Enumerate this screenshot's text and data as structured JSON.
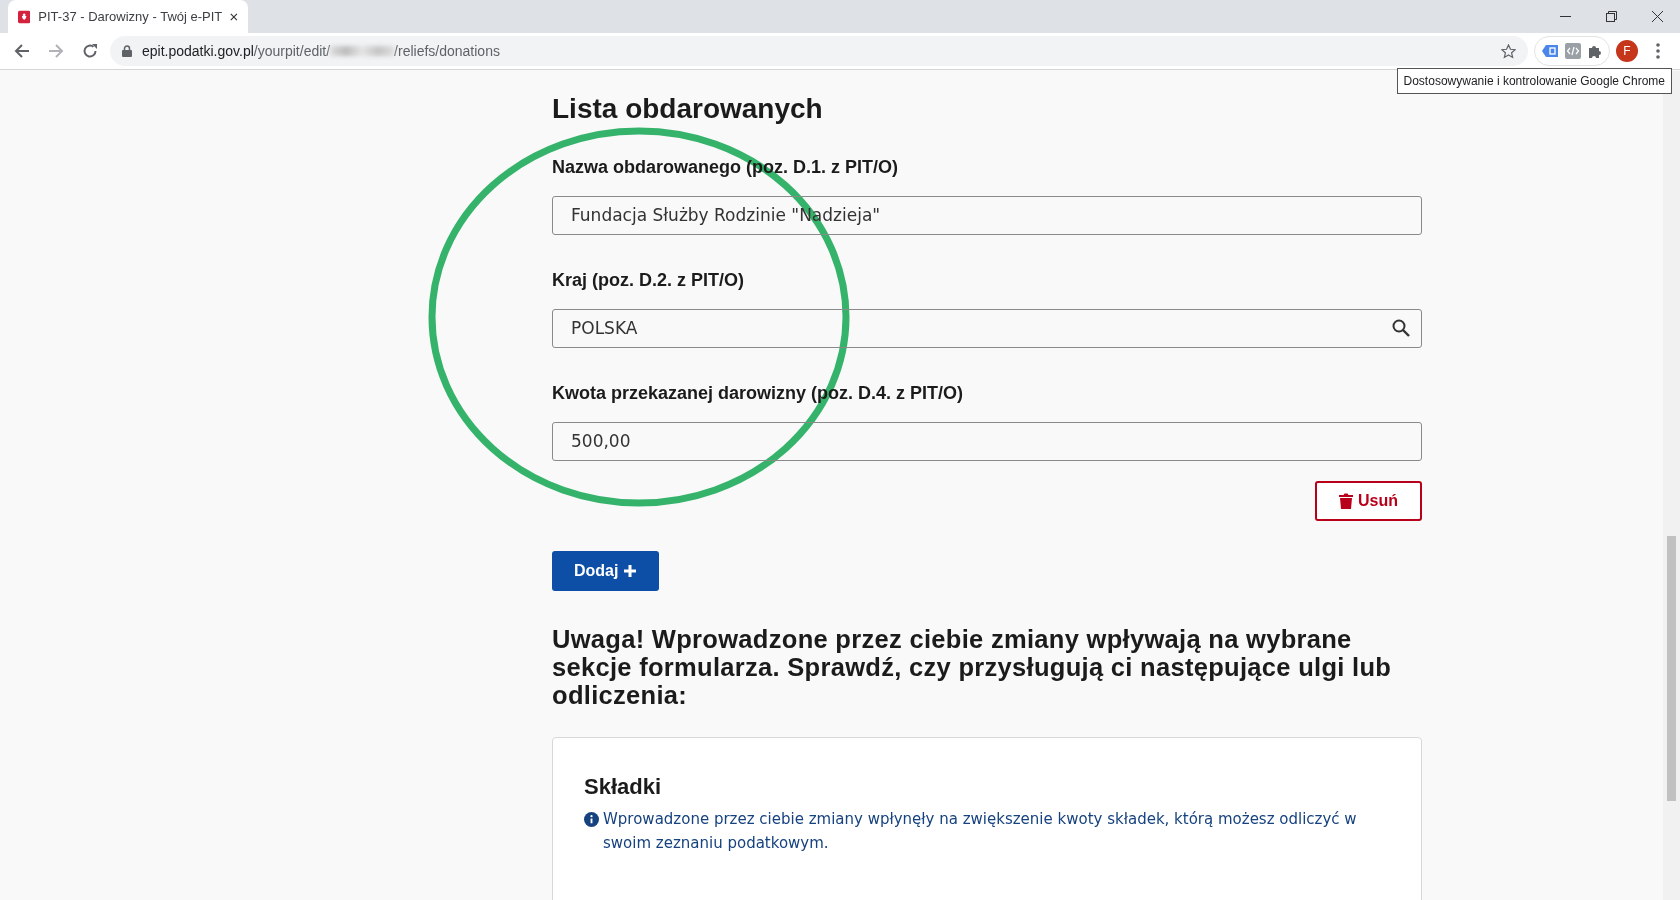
{
  "browser": {
    "tab_title": "PIT-37 - Darowizny - Twój e-PIT",
    "url_host": "epit.podatki.gov.pl",
    "url_path_start": "/yourpit/edit/",
    "url_path_end": "/reliefs/donations",
    "avatar": "F",
    "tooltip": "Dostosowywanie i kontrolowanie Google Chrome"
  },
  "heading": "Lista obdarowanych",
  "fields": [
    {
      "label": "Nazwa obdarowanego (poz. D.1. z PIT/O)",
      "value": "Fundacja Służby Rodzinie \"Nadzieja\"",
      "kind": "text"
    },
    {
      "label": "Kraj (poz. D.2. z PIT/O)",
      "value": "POLSKA",
      "kind": "search"
    },
    {
      "label": "Kwota przekazanej darowizny (poz. D.4. z PIT/O)",
      "value": "500,00",
      "kind": "text"
    }
  ],
  "remove_button": "Usuń",
  "add_button": "Dodaj",
  "warning": "Uwaga! Wprowadzone przez ciebie zmiany wpływają na wybrane sekcje formularza. Sprawdź, czy przysługują ci następujące ulgi lub odliczenia:",
  "card": {
    "title": "Składki",
    "info": "Wprowadzone przez ciebie zmiany wpłynęły na zwiększenie kwoty składek, którą możesz odliczyć w swoim zeznaniu podatkowym."
  }
}
